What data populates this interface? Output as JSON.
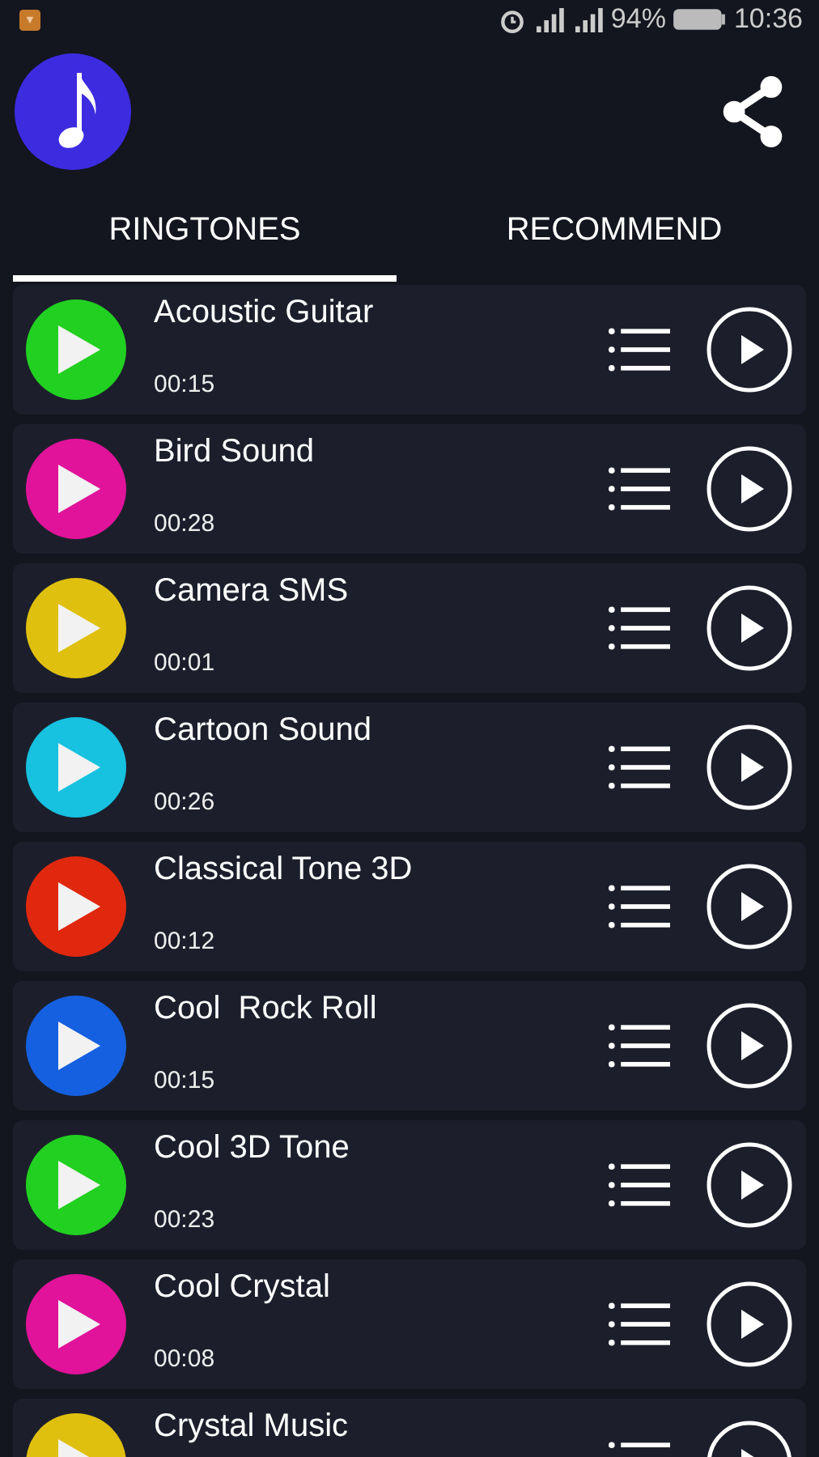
{
  "status_bar": {
    "battery": "94%",
    "time": "10:36"
  },
  "tabs": [
    {
      "label": "RINGTONES",
      "selected": true
    },
    {
      "label": "RECOMMEND",
      "selected": false
    }
  ],
  "ringtones": [
    {
      "title": "Acoustic Guitar",
      "duration": "00:15",
      "color": "#22d022"
    },
    {
      "title": "Bird Sound",
      "duration": "00:28",
      "color": "#e0139a"
    },
    {
      "title": "Camera SMS",
      "duration": "00:01",
      "color": "#dfc00e"
    },
    {
      "title": "Cartoon Sound",
      "duration": "00:26",
      "color": "#17c1e0"
    },
    {
      "title": "Classical Tone 3D",
      "duration": "00:12",
      "color": "#e0280f"
    },
    {
      "title": "Cool  Rock Roll",
      "duration": "00:15",
      "color": "#1560e0"
    },
    {
      "title": "Cool 3D Tone",
      "duration": "00:23",
      "color": "#22d022"
    },
    {
      "title": "Cool Crystal",
      "duration": "00:08",
      "color": "#e0139a"
    },
    {
      "title": "Crystal Music",
      "color": "#dfc00e"
    }
  ]
}
